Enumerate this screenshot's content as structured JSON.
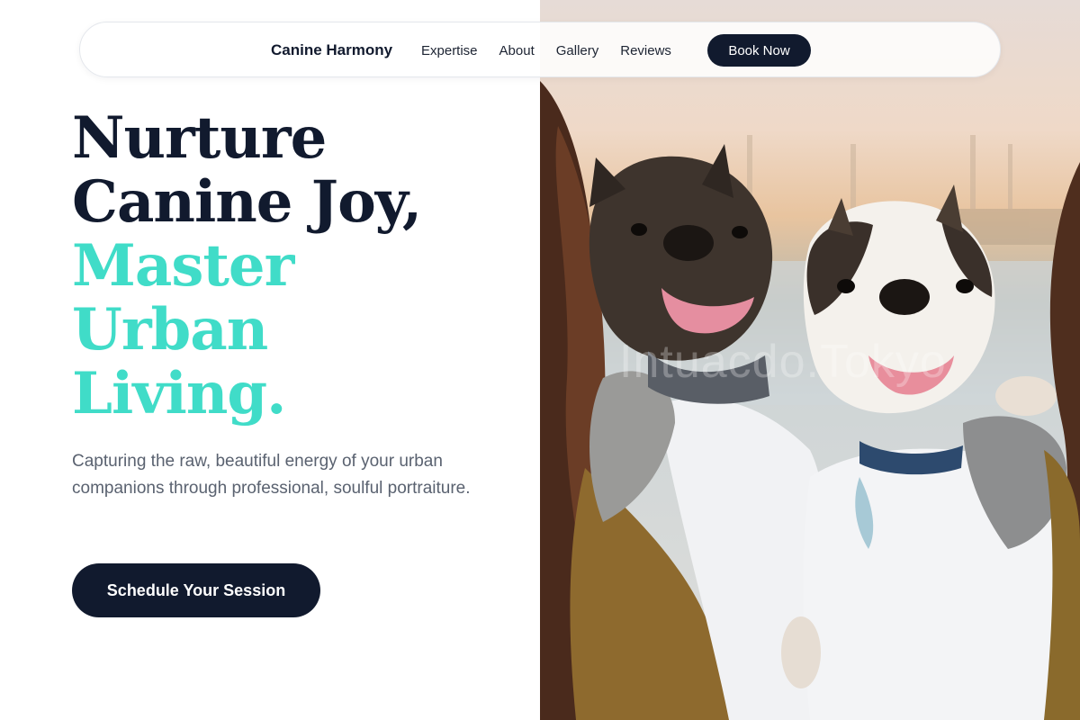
{
  "nav": {
    "brand": "Canine Harmony",
    "links": [
      "Expertise",
      "About",
      "Gallery",
      "Reviews"
    ],
    "cta_label": "Book Now"
  },
  "hero": {
    "headline_dark": [
      "Nurture",
      "Canine Joy,"
    ],
    "headline_accent": [
      "Master",
      "Urban",
      "Living."
    ],
    "subtext": "Capturing the raw, beautiful energy of your urban companions through professional, soulful portraiture.",
    "cta_label": "Schedule Your Session"
  },
  "image": {
    "description_icon": "photo-two-french-bulldogs",
    "watermark": "Intuacdo.Tokyo"
  },
  "colors": {
    "primary": "#111a2e",
    "accent": "#40dcc8",
    "body_text": "#5a6270",
    "background": "#ffffff"
  }
}
